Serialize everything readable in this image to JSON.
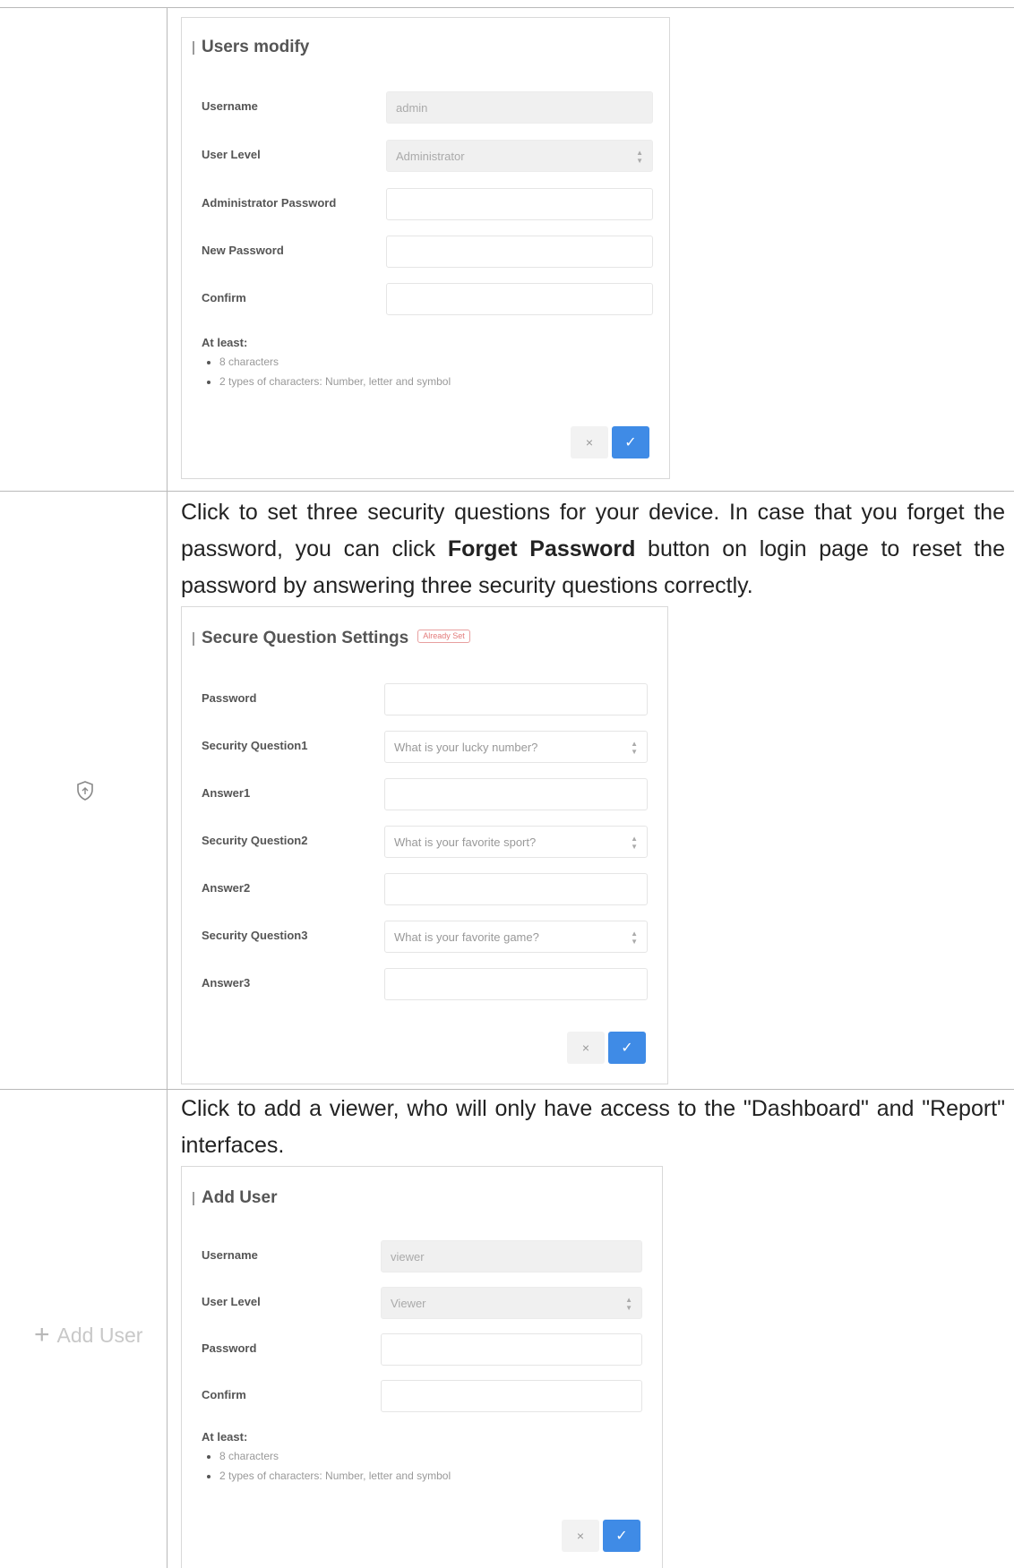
{
  "users_modify": {
    "title": "Users modify",
    "fields": [
      {
        "label": "Username",
        "value": "admin",
        "disabled": true
      },
      {
        "label": "User Level",
        "value": "Administrator",
        "disabled": true,
        "select": true
      },
      {
        "label": "Administrator Password",
        "value": ""
      },
      {
        "label": "New Password",
        "value": ""
      },
      {
        "label": "Confirm",
        "value": ""
      }
    ],
    "rules_head": "At least:",
    "rules": [
      "8 characters",
      "2 types of characters: Number, letter and symbol"
    ],
    "cancel_label": "×",
    "ok_label": "✓"
  },
  "security_section": {
    "desc_part1": "Click to set three security questions for your device. In case that you forget the password, you can click ",
    "desc_bold": "Forget Password",
    "desc_part2": " button on login page to reset the password by answering three security questions correctly.",
    "icon": "shield-icon"
  },
  "secure_question": {
    "title": "Secure Question Settings",
    "badge": "Already Set",
    "fields": [
      {
        "label": "Password",
        "value": ""
      },
      {
        "label": "Security Question1",
        "value": "What is your lucky number?",
        "select": true
      },
      {
        "label": "Answer1",
        "value": ""
      },
      {
        "label": "Security Question2",
        "value": "What is your favorite sport?",
        "select": true
      },
      {
        "label": "Answer2",
        "value": ""
      },
      {
        "label": "Security Question3",
        "value": "What is your favorite game?",
        "select": true
      },
      {
        "label": "Answer3",
        "value": ""
      }
    ],
    "cancel_label": "×",
    "ok_label": "✓"
  },
  "add_user_section": {
    "desc": "Click to add a viewer, who will only have access to the \"Dashboard\" and \"Report\" interfaces.",
    "link_plus": "+",
    "link_label": "Add User"
  },
  "add_user": {
    "title": "Add User",
    "fields": [
      {
        "label": "Username",
        "value": "viewer",
        "disabled": true
      },
      {
        "label": "User Level",
        "value": "Viewer",
        "disabled": true,
        "select": true
      },
      {
        "label": "Password",
        "value": ""
      },
      {
        "label": "Confirm",
        "value": ""
      }
    ],
    "rules_head": "At least:",
    "rules": [
      "8 characters",
      "2 types of characters: Number, letter and symbol"
    ],
    "cancel_label": "×",
    "ok_label": "✓"
  }
}
